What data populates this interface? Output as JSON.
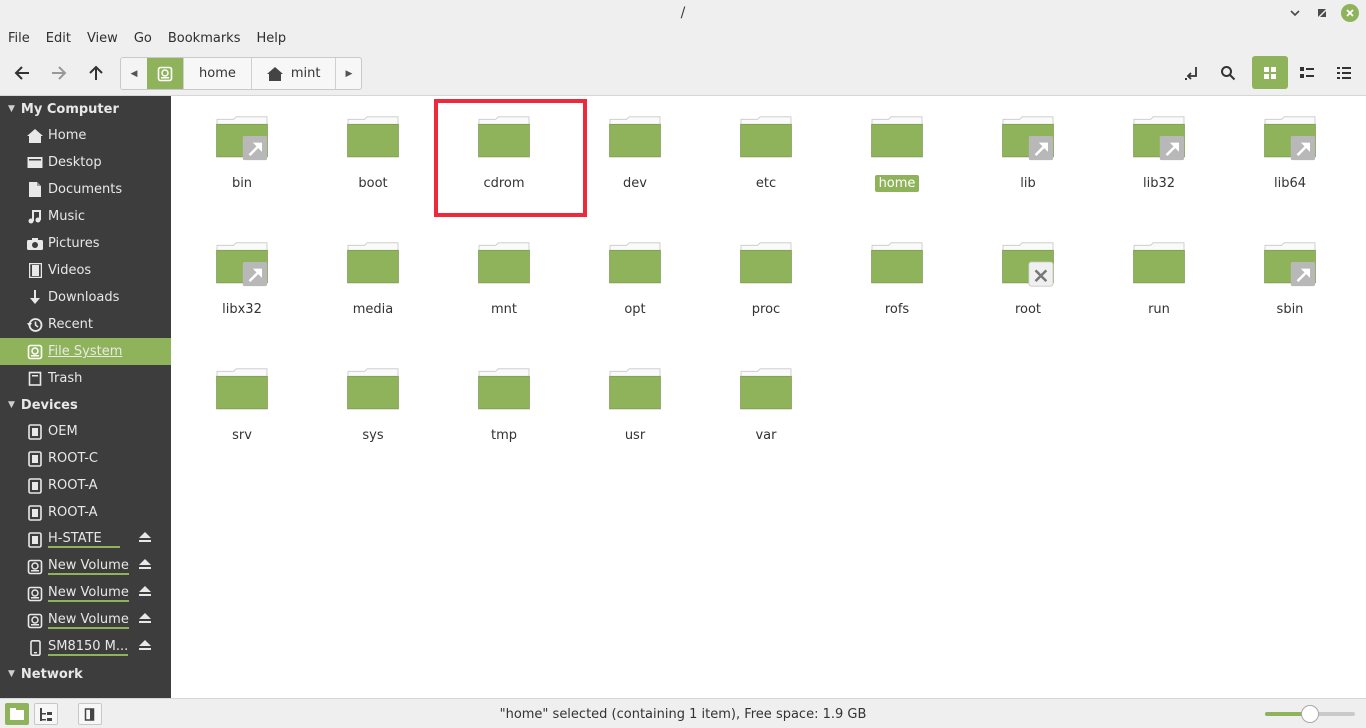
{
  "window": {
    "title": "/",
    "minimize": "⌄",
    "maximize": "⌃",
    "close": "✕"
  },
  "menubar": {
    "items": [
      "File",
      "Edit",
      "View",
      "Go",
      "Bookmarks",
      "Help"
    ]
  },
  "toolbar": {
    "back": "←",
    "forward": "→",
    "up": "↑",
    "path": [
      "home",
      "mint"
    ]
  },
  "sidebar": {
    "sections": [
      {
        "header": "My Computer",
        "items": [
          {
            "label": "Home",
            "icon": "home-icon"
          },
          {
            "label": "Desktop",
            "icon": "desktop-icon"
          },
          {
            "label": "Documents",
            "icon": "document-icon"
          },
          {
            "label": "Music",
            "icon": "music-icon"
          },
          {
            "label": "Pictures",
            "icon": "camera-icon"
          },
          {
            "label": "Videos",
            "icon": "film-icon"
          },
          {
            "label": "Downloads",
            "icon": "download-icon"
          },
          {
            "label": "Recent",
            "icon": "recent-icon"
          },
          {
            "label": "File System",
            "icon": "drive-icon",
            "selected": true
          },
          {
            "label": "Trash",
            "icon": "trash-icon"
          }
        ]
      },
      {
        "header": "Devices",
        "items": [
          {
            "label": "OEM",
            "icon": "chip-icon"
          },
          {
            "label": "ROOT-C",
            "icon": "chip-icon"
          },
          {
            "label": "ROOT-A",
            "icon": "chip-icon"
          },
          {
            "label": "ROOT-A",
            "icon": "chip-icon"
          },
          {
            "label": "H-STATE",
            "icon": "chip-icon",
            "eject": true
          },
          {
            "label": "New Volume",
            "icon": "drive-icon",
            "eject": true
          },
          {
            "label": "New Volume",
            "icon": "drive-icon",
            "eject": true
          },
          {
            "label": "New Volume",
            "icon": "drive-icon",
            "eject": true
          },
          {
            "label": "SM8150 M...",
            "icon": "phone-icon",
            "eject": true
          }
        ]
      },
      {
        "header": "Network",
        "items": []
      }
    ]
  },
  "files": [
    {
      "name": "bin",
      "badge": "link"
    },
    {
      "name": "boot"
    },
    {
      "name": "cdrom"
    },
    {
      "name": "dev"
    },
    {
      "name": "etc"
    },
    {
      "name": "home",
      "selected": true
    },
    {
      "name": "lib",
      "badge": "link"
    },
    {
      "name": "lib32",
      "badge": "link"
    },
    {
      "name": "lib64",
      "badge": "link"
    },
    {
      "name": "libx32",
      "badge": "link"
    },
    {
      "name": "media"
    },
    {
      "name": "mnt"
    },
    {
      "name": "opt"
    },
    {
      "name": "proc"
    },
    {
      "name": "rofs"
    },
    {
      "name": "root",
      "badge": "locked"
    },
    {
      "name": "run"
    },
    {
      "name": "sbin",
      "badge": "link"
    },
    {
      "name": "srv"
    },
    {
      "name": "sys"
    },
    {
      "name": "tmp"
    },
    {
      "name": "usr"
    },
    {
      "name": "var"
    }
  ],
  "status": {
    "text": "\"home\" selected (containing 1 item), Free space: 1.9 GB",
    "zoom": 0.5
  },
  "colors": {
    "accent": "#8fb35b",
    "sidebar_bg": "#3d3d3d",
    "highlight": "#f0283c"
  }
}
